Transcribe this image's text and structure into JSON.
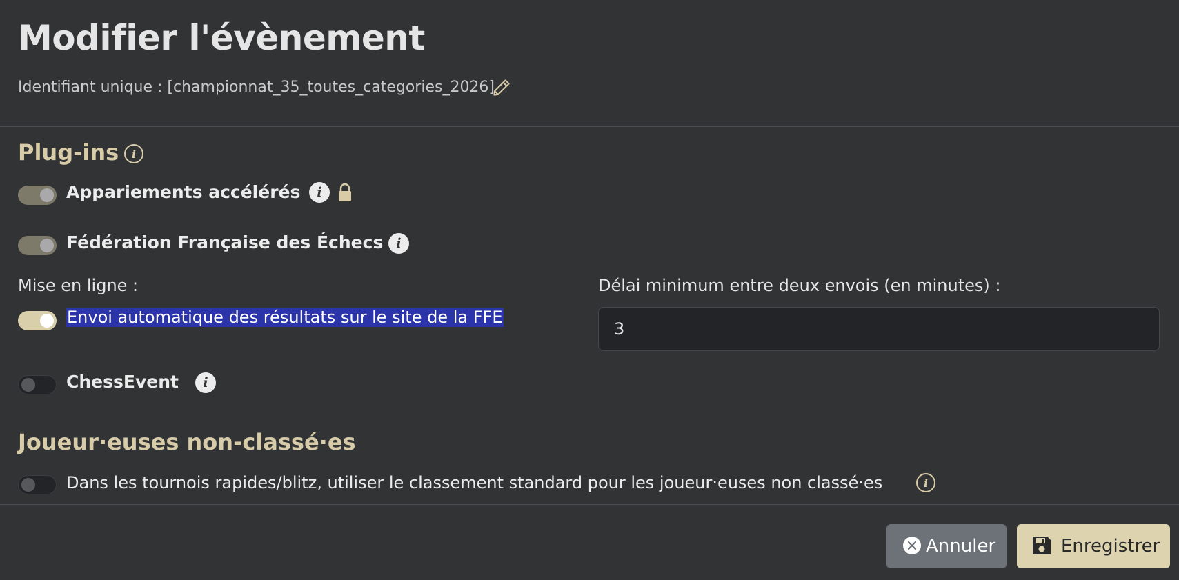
{
  "header": {
    "title": "Modifier l'évènement",
    "unique_id_label": "Identifiant unique : [championnat_35_toutes_categories_2026]",
    "edit_icon": "pencil-icon"
  },
  "plugins": {
    "section_title": "Plug-ins",
    "accelerated_pairings": {
      "label": "Appariements accélérés",
      "state": "on (disabled)",
      "locked": true
    },
    "ffe": {
      "label": "Fédération Française des Échecs",
      "state": "on (disabled)",
      "upload_label": "Mise en ligne :",
      "auto_send_label": "Envoi automatique des résultats sur le site de la FFE",
      "auto_send_state": "on",
      "delay_label": "Délai minimum entre deux envois (en minutes) :",
      "delay_value": "3"
    },
    "chessevent": {
      "label": "ChessEvent",
      "state": "off"
    }
  },
  "unrated": {
    "section_title": "Joueur·euses non-classé·es",
    "option_label": "Dans les tournois rapides/blitz, utiliser le classement standard pour les joueur·euses non classé·es",
    "state": "off"
  },
  "footer": {
    "cancel_label": "Annuler",
    "save_label": "Enregistrer"
  },
  "colors": {
    "background": "#323335",
    "accent": "#d8cba8",
    "selection": "#2b34a8",
    "cancel_button": "#6d7279",
    "save_button": "#ddd3ae"
  }
}
